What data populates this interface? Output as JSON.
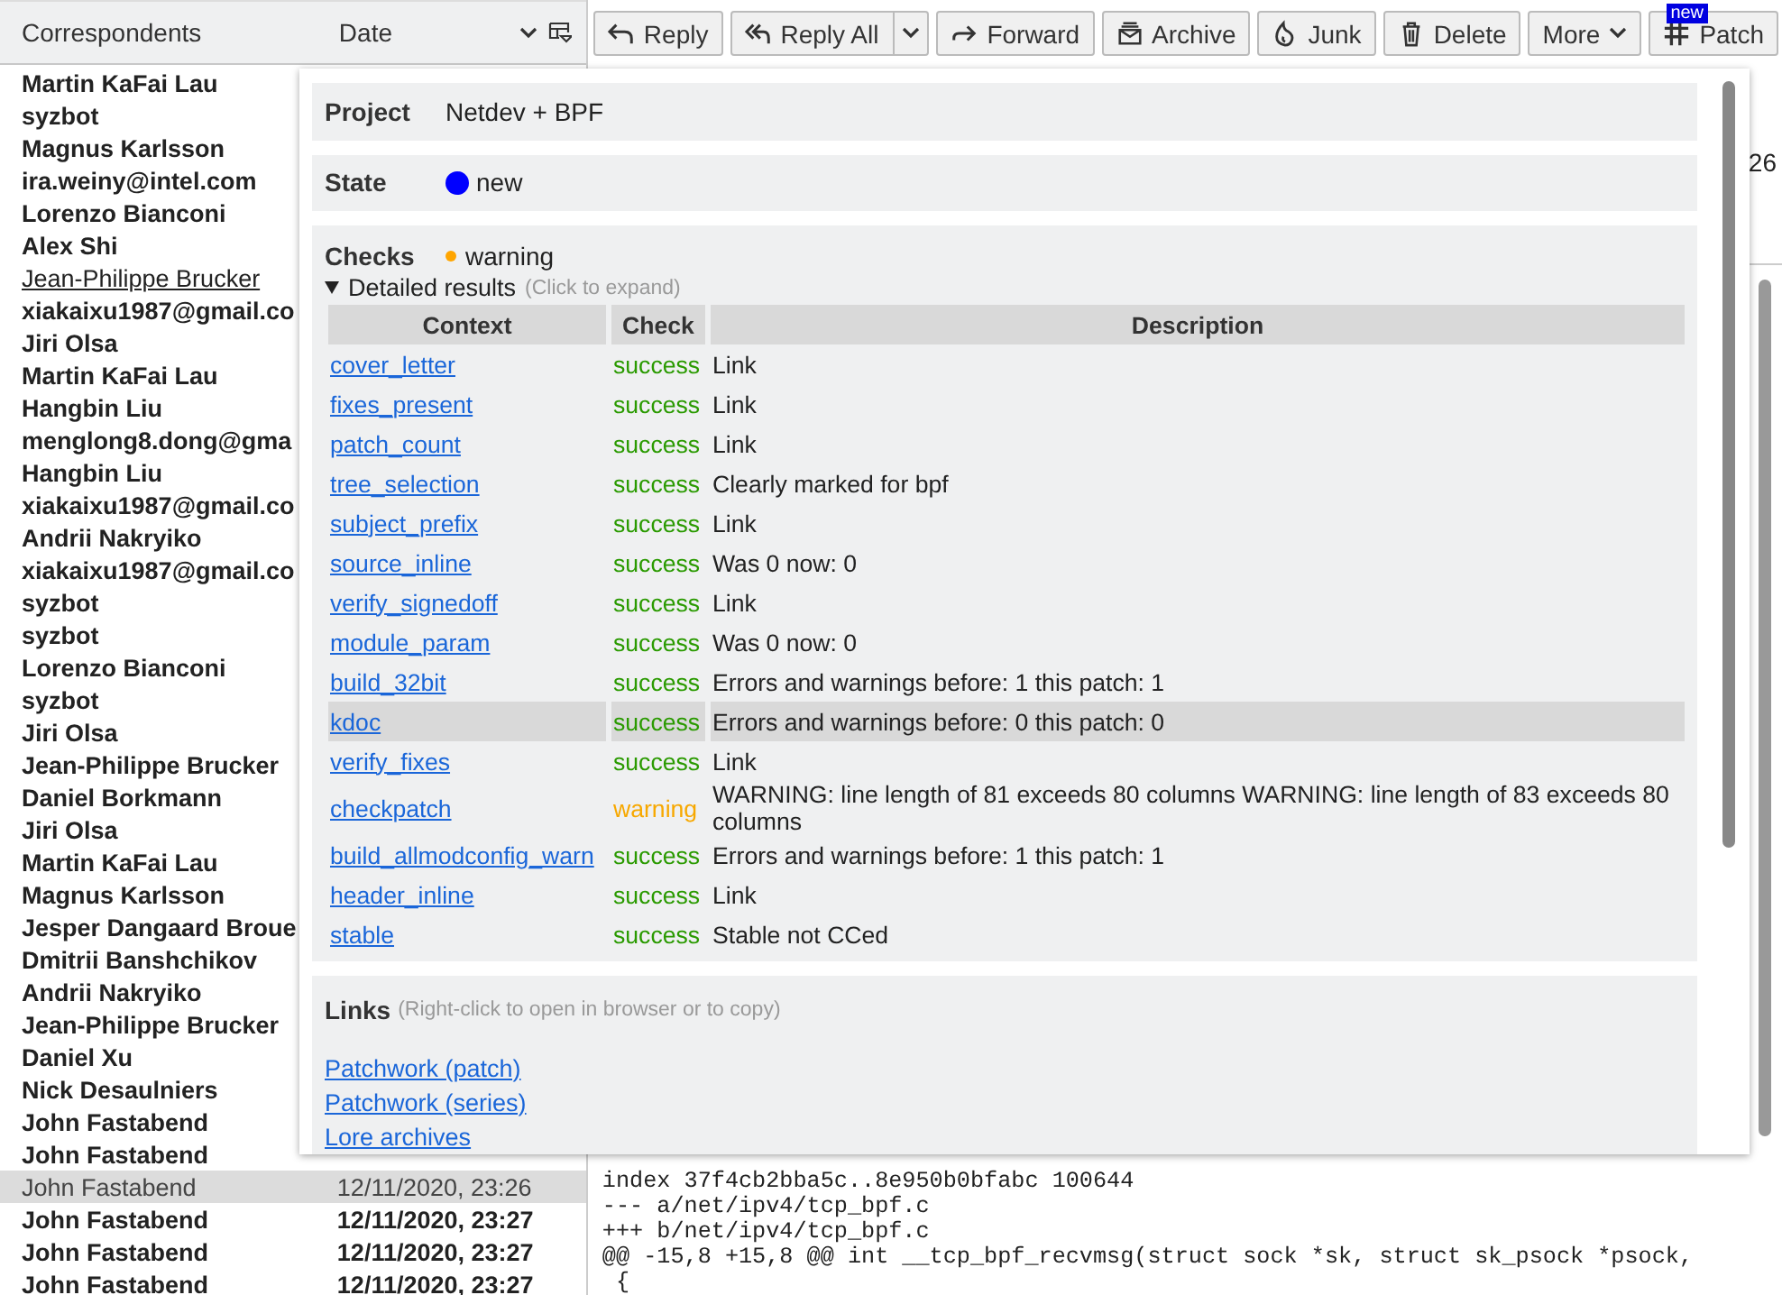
{
  "message_list": {
    "columns": [
      "Correspondents",
      "Date"
    ],
    "rows": [
      {
        "name": "Martin KaFai Lau",
        "unread": true,
        "selected": false,
        "hovered": false
      },
      {
        "name": "syzbot",
        "unread": true,
        "selected": false,
        "hovered": false
      },
      {
        "name": "Magnus Karlsson",
        "unread": true,
        "selected": false,
        "hovered": false
      },
      {
        "name": "ira.weiny@intel.com",
        "unread": true,
        "selected": false,
        "hovered": false
      },
      {
        "name": "Lorenzo Bianconi",
        "unread": true,
        "selected": false,
        "hovered": false
      },
      {
        "name": "Alex Shi",
        "unread": true,
        "selected": false,
        "hovered": false
      },
      {
        "name": "Jean-Philippe Brucker",
        "unread": false,
        "selected": false,
        "hovered": true
      },
      {
        "name": "xiakaixu1987@gmail.co",
        "unread": true,
        "selected": false,
        "hovered": false
      },
      {
        "name": "Jiri Olsa",
        "unread": true,
        "selected": false,
        "hovered": false
      },
      {
        "name": "Martin KaFai Lau",
        "unread": true,
        "selected": false,
        "hovered": false
      },
      {
        "name": "Hangbin Liu",
        "unread": true,
        "selected": false,
        "hovered": false
      },
      {
        "name": "menglong8.dong@gma",
        "unread": true,
        "selected": false,
        "hovered": false
      },
      {
        "name": "Hangbin Liu",
        "unread": true,
        "selected": false,
        "hovered": false
      },
      {
        "name": "xiakaixu1987@gmail.co",
        "unread": true,
        "selected": false,
        "hovered": false
      },
      {
        "name": "Andrii Nakryiko",
        "unread": true,
        "selected": false,
        "hovered": false
      },
      {
        "name": "xiakaixu1987@gmail.co",
        "unread": true,
        "selected": false,
        "hovered": false
      },
      {
        "name": "syzbot",
        "unread": true,
        "selected": false,
        "hovered": false
      },
      {
        "name": "syzbot",
        "unread": true,
        "selected": false,
        "hovered": false
      },
      {
        "name": "Lorenzo Bianconi",
        "unread": true,
        "selected": false,
        "hovered": false
      },
      {
        "name": "syzbot",
        "unread": true,
        "selected": false,
        "hovered": false
      },
      {
        "name": "Jiri Olsa",
        "unread": true,
        "selected": false,
        "hovered": false
      },
      {
        "name": "Jean-Philippe Brucker",
        "unread": true,
        "selected": false,
        "hovered": false
      },
      {
        "name": "Daniel Borkmann",
        "unread": true,
        "selected": false,
        "hovered": false
      },
      {
        "name": "Jiri Olsa",
        "unread": true,
        "selected": false,
        "hovered": false
      },
      {
        "name": "Martin KaFai Lau",
        "unread": true,
        "selected": false,
        "hovered": false
      },
      {
        "name": "Magnus Karlsson",
        "unread": true,
        "selected": false,
        "hovered": false
      },
      {
        "name": "Jesper Dangaard Broue",
        "unread": true,
        "selected": false,
        "hovered": false
      },
      {
        "name": "Dmitrii Banshchikov",
        "unread": true,
        "selected": false,
        "hovered": false
      },
      {
        "name": "Andrii Nakryiko",
        "unread": true,
        "selected": false,
        "hovered": false
      },
      {
        "name": "Jean-Philippe Brucker",
        "unread": true,
        "selected": false,
        "hovered": false
      },
      {
        "name": "Daniel Xu",
        "unread": true,
        "selected": false,
        "hovered": false
      },
      {
        "name": "Nick Desaulniers",
        "unread": true,
        "selected": false,
        "hovered": false
      },
      {
        "name": "John Fastabend",
        "unread": true,
        "selected": false,
        "hovered": false
      },
      {
        "name": "John Fastabend",
        "unread": true,
        "selected": false,
        "hovered": false
      },
      {
        "name": "John Fastabend",
        "date": "12/11/2020, 23:26",
        "unread": false,
        "selected": true,
        "hovered": false
      },
      {
        "name": "John Fastabend",
        "date": "12/11/2020, 23:27",
        "unread": true,
        "selected": false,
        "hovered": false
      },
      {
        "name": "John Fastabend",
        "date": "12/11/2020, 23:27",
        "unread": true,
        "selected": false,
        "hovered": false
      },
      {
        "name": "John Fastabend",
        "date": "12/11/2020, 23:27",
        "unread": true,
        "selected": false,
        "hovered": false
      }
    ]
  },
  "toolbar": [
    {
      "kind": "reply",
      "label": "Reply"
    },
    {
      "kind": "reply_all",
      "label": "Reply All"
    },
    {
      "kind": "forward",
      "label": "Forward"
    },
    {
      "kind": "archive",
      "label": "Archive"
    },
    {
      "kind": "junk",
      "label": "Junk"
    },
    {
      "kind": "delete",
      "label": "Delete"
    },
    {
      "kind": "more",
      "label": "More"
    },
    {
      "kind": "patch",
      "label": "Patch",
      "badge": "new"
    }
  ],
  "header_fragment": "26",
  "message_body": [
    "index 37f4cb2bba5c..8e950b0bfabc 100644",
    "--- a/net/ipv4/tcp_bpf.c",
    "+++ b/net/ipv4/tcp_bpf.c",
    "@@ -15,8 +15,8 @@ int __tcp_bpf_recvmsg(struct sock *sk, struct sk_psock *psock,",
    " {"
  ],
  "patch_popup": {
    "project": {
      "label": "Project",
      "value": "Netdev + BPF"
    },
    "state": {
      "label": "State",
      "value": "new",
      "color": "#0000ff"
    },
    "checks": {
      "label": "Checks",
      "value": "warning",
      "color": "#ffa500",
      "details_label": "Detailed results",
      "details_hint": "(Click to expand)",
      "expanded": true,
      "columns": [
        "Context",
        "Check",
        "Description"
      ],
      "rows": [
        {
          "context": "cover_letter",
          "check": "success",
          "kind": "success",
          "description": "Link",
          "hovered": false
        },
        {
          "context": "fixes_present",
          "check": "success",
          "kind": "success",
          "description": "Link",
          "hovered": false
        },
        {
          "context": "patch_count",
          "check": "success",
          "kind": "success",
          "description": "Link",
          "hovered": false
        },
        {
          "context": "tree_selection",
          "check": "success",
          "kind": "success",
          "description": "Clearly marked for bpf",
          "hovered": false
        },
        {
          "context": "subject_prefix",
          "check": "success",
          "kind": "success",
          "description": "Link",
          "hovered": false
        },
        {
          "context": "source_inline",
          "check": "success",
          "kind": "success",
          "description": "Was 0 now: 0",
          "hovered": false
        },
        {
          "context": "verify_signedoff",
          "check": "success",
          "kind": "success",
          "description": "Link",
          "hovered": false
        },
        {
          "context": "module_param",
          "check": "success",
          "kind": "success",
          "description": "Was 0 now: 0",
          "hovered": false
        },
        {
          "context": "build_32bit",
          "check": "success",
          "kind": "success",
          "description": "Errors and warnings before: 1 this patch: 1",
          "hovered": false
        },
        {
          "context": "kdoc",
          "check": "success",
          "kind": "success",
          "description": "Errors and warnings before: 0 this patch: 0",
          "hovered": true
        },
        {
          "context": "verify_fixes",
          "check": "success",
          "kind": "success",
          "description": "Link",
          "hovered": false
        },
        {
          "context": "checkpatch",
          "check": "warning",
          "kind": "warning",
          "description": "WARNING: line length of 81 exceeds 80 columns WARNING: line length of 83 exceeds 80 columns",
          "hovered": false
        },
        {
          "context": "build_allmodconfig_warn",
          "check": "success",
          "kind": "success",
          "description": "Errors and warnings before: 1 this patch: 1",
          "hovered": false
        },
        {
          "context": "header_inline",
          "check": "success",
          "kind": "success",
          "description": "Link",
          "hovered": false
        },
        {
          "context": "stable",
          "check": "success",
          "kind": "success",
          "description": "Stable not CCed",
          "hovered": false
        }
      ]
    },
    "links": {
      "label": "Links",
      "hint": "(Right-click to open in browser or to copy)",
      "items": [
        "Patchwork (patch)",
        "Patchwork (series)",
        "Lore archives"
      ]
    }
  }
}
